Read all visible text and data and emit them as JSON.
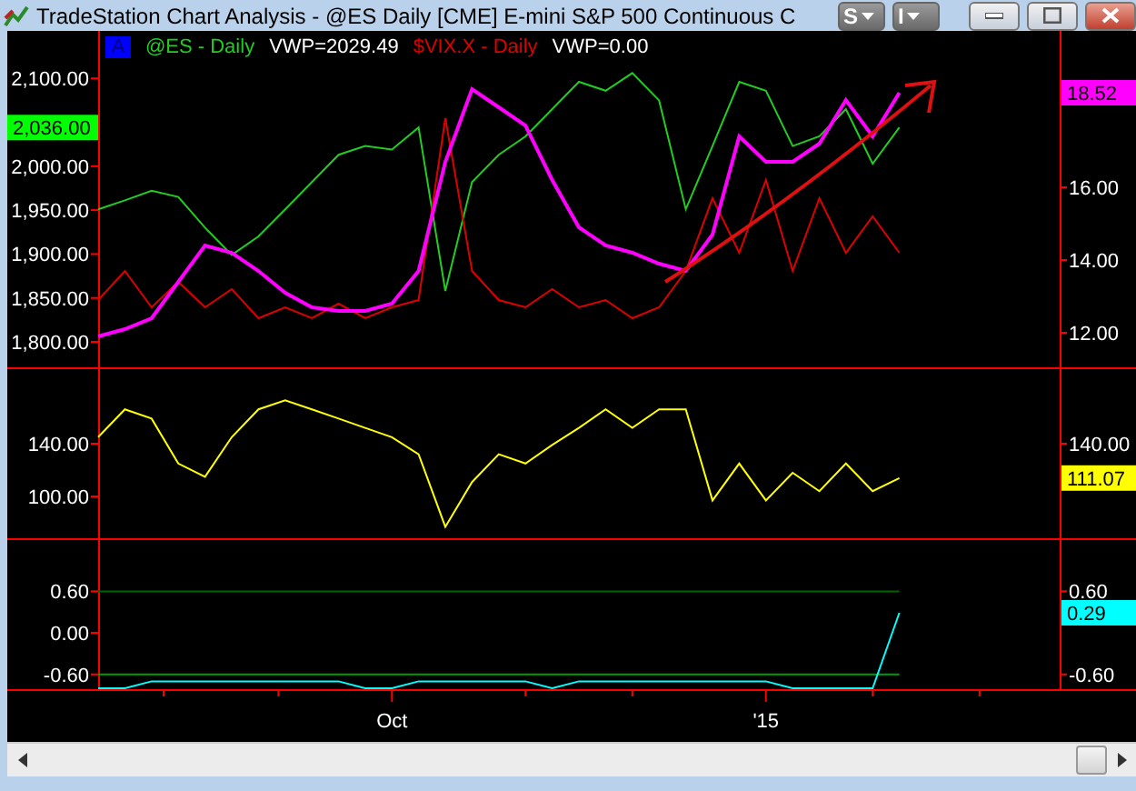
{
  "window": {
    "title": "TradeStation Chart Analysis - @ES Daily [CME] E-mini S&P 500 Continuous C",
    "toolbar_buttons": [
      "S",
      "I"
    ]
  },
  "legend": {
    "badge": "A",
    "values": [
      "VWP=2029.49",
      "VWP=0.00"
    ]
  },
  "panes": [
    {
      "chart_data": {
        "type": "line",
        "categories": [
          null,
          null,
          null,
          null,
          null,
          null,
          null,
          null,
          null,
          null,
          null,
          null,
          null,
          null,
          null,
          null,
          null,
          null,
          null,
          null,
          null,
          null,
          null,
          null,
          null,
          null,
          null,
          null,
          null,
          null,
          null
        ],
        "ylim": [
          1769,
          2154
        ],
        "yticks": [
          {
            "value": 2100,
            "label": "2,100.00"
          },
          {
            "value": 2000,
            "label": "2,000.00"
          },
          {
            "value": 1950,
            "label": "1,950.00"
          },
          {
            "value": 1900,
            "label": "1,900.00"
          },
          {
            "value": 1850,
            "label": "1,850.00"
          },
          {
            "value": 1800,
            "label": "1,800.00"
          }
        ],
        "y2lim": [
          11,
          20.3
        ],
        "y2ticks": [
          {
            "value": 16,
            "label": "16.00"
          },
          {
            "value": 14,
            "label": "14.00"
          },
          {
            "value": 12,
            "label": "12.00"
          }
        ],
        "series": [
          {
            "name": "@ES - Daily",
            "color": "#22cc22",
            "values": [
              1951,
              1961,
              1972,
              1965,
              1930,
              1899,
              1920,
              1951,
              1982,
              2013,
              2023,
              2019,
              2044,
              1858,
              1982,
              2013,
              2034,
              2065,
              2096,
              2086,
              2106,
              2075,
              1951,
              2023,
              2096,
              2086,
              2023,
              2034,
              2065,
              2003,
              2044
            ]
          },
          {
            "name": "$VIX.X - Daily",
            "color": "#dd0000",
            "axis": "y2",
            "values": [
              12.9,
              13.7,
              12.7,
              13.4,
              12.7,
              13.2,
              12.4,
              12.7,
              12.4,
              12.8,
              12.4,
              12.7,
              12.9,
              17.9,
              13.7,
              12.9,
              12.7,
              13.2,
              12.7,
              12.9,
              12.4,
              12.7,
              13.7,
              15.7,
              14.2,
              16.2,
              13.7,
              15.7,
              14.2,
              15.2,
              14.2
            ]
          },
          {
            "color": "#ff00ff",
            "axis": "y2",
            "values": [
              11.9,
              12.1,
              12.4,
              13.4,
              14.4,
              14.2,
              13.7,
              13.1,
              12.7,
              12.6,
              12.6,
              12.8,
              13.7,
              16.7,
              18.7,
              18.2,
              17.7,
              16.2,
              14.9,
              14.4,
              14.2,
              13.9,
              13.7,
              14.7,
              17.4,
              16.7,
              16.7,
              17.2,
              18.4,
              17.4,
              18.6
            ]
          }
        ]
      },
      "left_tag": {
        "text": "2,036.00",
        "color": "#00ff00"
      },
      "right_tag": {
        "text": "18.52",
        "color": "#ff00ff"
      }
    },
    {
      "chart_data": {
        "type": "line",
        "categories": [
          null,
          null,
          null,
          null,
          null,
          null,
          null,
          null,
          null,
          null,
          null,
          null,
          null,
          null,
          null,
          null,
          null,
          null,
          null,
          null,
          null,
          null,
          null,
          null,
          null,
          null,
          null,
          null,
          null,
          null,
          null
        ],
        "ylim": [
          67,
          196.5
        ],
        "yticks": [
          {
            "value": 140,
            "label": "140.00"
          },
          {
            "value": 100,
            "label": "100.00"
          }
        ],
        "annotations": [
          "140.00"
        ],
        "series": [
          {
            "color": "#ffff00",
            "values": [
              145,
              166,
              159,
              125,
              115,
              145,
              166,
              173,
              166,
              159,
              152,
              145,
              132,
              77,
              111,
              132,
              125,
              139,
              152,
              166,
              152,
              166,
              166,
              97,
              125,
              97,
              118,
              104,
              125,
              104,
              114
            ]
          }
        ]
      },
      "right_tag": {
        "text": "111.07",
        "color": "#ffff00"
      }
    },
    {
      "chart_data": {
        "type": "line",
        "categories": [
          null,
          null,
          null,
          null,
          null,
          null,
          null,
          null,
          null,
          null,
          null,
          "Oct",
          null,
          null,
          null,
          null,
          null,
          null,
          null,
          null,
          null,
          null,
          null,
          null,
          null,
          "'15",
          null,
          null,
          null,
          null,
          null
        ],
        "ylim": [
          -0.84,
          1.34
        ],
        "yticks": [
          {
            "value": 0.6,
            "label": "0.60"
          },
          {
            "value": 0,
            "label": "0.00"
          },
          {
            "value": -0.6,
            "label": "-0.60"
          }
        ],
        "annotations": [
          "0.60",
          null,
          "-0.60"
        ],
        "series": [
          {
            "color": "#006400",
            "values": [
              0.6,
              0.6,
              0.6,
              0.6,
              0.6,
              0.6,
              0.6,
              0.6,
              0.6,
              0.6,
              0.6,
              0.6,
              0.6,
              0.6,
              0.6,
              0.6,
              0.6,
              0.6,
              0.6,
              0.6,
              0.6,
              0.6,
              0.6,
              0.6,
              0.6,
              0.6,
              0.6,
              0.6,
              0.6,
              0.6,
              0.6
            ]
          },
          {
            "color": "#00a000",
            "values": [
              -0.6,
              -0.6,
              -0.6,
              -0.6,
              -0.6,
              -0.6,
              -0.6,
              -0.6,
              -0.6,
              -0.6,
              -0.6,
              -0.6,
              -0.6,
              -0.6,
              -0.6,
              -0.6,
              -0.6,
              -0.6,
              -0.6,
              -0.6,
              -0.6,
              -0.6,
              -0.6,
              -0.6,
              -0.6,
              -0.6,
              -0.6,
              -0.6,
              -0.6,
              -0.6,
              -0.6
            ]
          },
          {
            "color": "#00ffff",
            "values": [
              -0.8,
              -0.8,
              -0.7,
              -0.7,
              -0.7,
              -0.7,
              -0.7,
              -0.7,
              -0.7,
              -0.7,
              -0.8,
              -0.8,
              -0.7,
              -0.7,
              -0.7,
              -0.7,
              -0.7,
              -0.8,
              -0.7,
              -0.7,
              -0.7,
              -0.7,
              -0.7,
              -0.7,
              -0.7,
              -0.7,
              -0.8,
              -0.8,
              -0.8,
              -0.8,
              0.29
            ]
          }
        ]
      },
      "right_tag": {
        "text": "0.29",
        "color": "#00ffff"
      }
    }
  ]
}
